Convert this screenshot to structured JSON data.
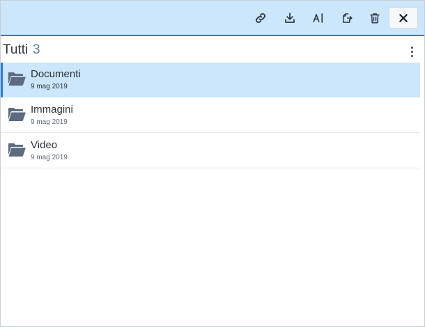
{
  "toolbar": {
    "actions": [
      {
        "name": "link",
        "icon": "link-icon"
      },
      {
        "name": "download",
        "icon": "download-icon"
      },
      {
        "name": "rename",
        "icon": "rename-icon"
      },
      {
        "name": "move",
        "icon": "move-icon"
      },
      {
        "name": "delete",
        "icon": "trash-icon"
      }
    ],
    "close_icon": "close-icon"
  },
  "list": {
    "filter_label": "Tutti",
    "count": "3",
    "more_icon": "more-vertical-icon",
    "items": [
      {
        "name": "Documenti",
        "date": "9 mag 2019",
        "selected": true,
        "icon": "folder-open-icon"
      },
      {
        "name": "Immagini",
        "date": "9 mag 2019",
        "selected": false,
        "icon": "folder-open-icon"
      },
      {
        "name": "Video",
        "date": "9 mag 2019",
        "selected": false,
        "icon": "folder-open-icon"
      }
    ]
  },
  "colors": {
    "toolbar_bg": "#cce6fb",
    "accent": "#2b7bd6",
    "folder": "#5b6c80"
  }
}
